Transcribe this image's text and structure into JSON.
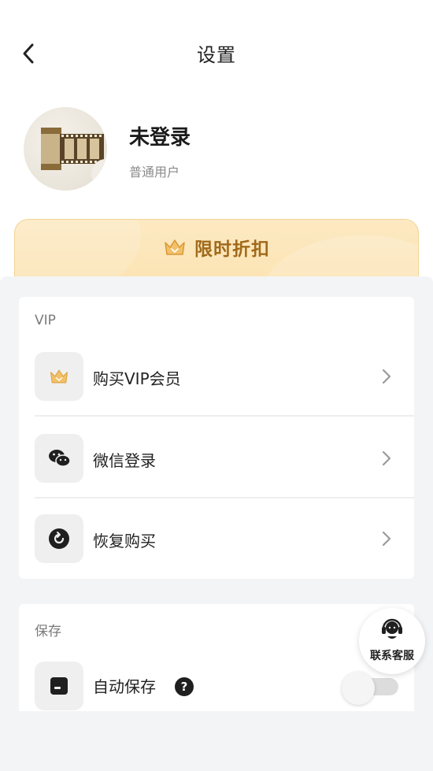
{
  "header": {
    "title": "设置"
  },
  "profile": {
    "name": "未登录",
    "type": "普通用户"
  },
  "promo": {
    "label": "限时折扣"
  },
  "sections": {
    "vip": {
      "title": "VIP",
      "items": [
        {
          "label": "购买VIP会员",
          "icon": "crown-icon"
        },
        {
          "label": "微信登录",
          "icon": "wechat-icon"
        },
        {
          "label": "恢复购买",
          "icon": "restore-icon"
        }
      ]
    },
    "save": {
      "title": "保存",
      "items": [
        {
          "label": "自动保存",
          "icon": "save-icon",
          "help": "?",
          "toggle": "off"
        }
      ]
    }
  },
  "support": {
    "label": "联系客服"
  },
  "colors": {
    "accent_gold": "#a06a1a",
    "promo_bg": "#fde9c2",
    "sheet_bg": "#f3f4f6"
  }
}
